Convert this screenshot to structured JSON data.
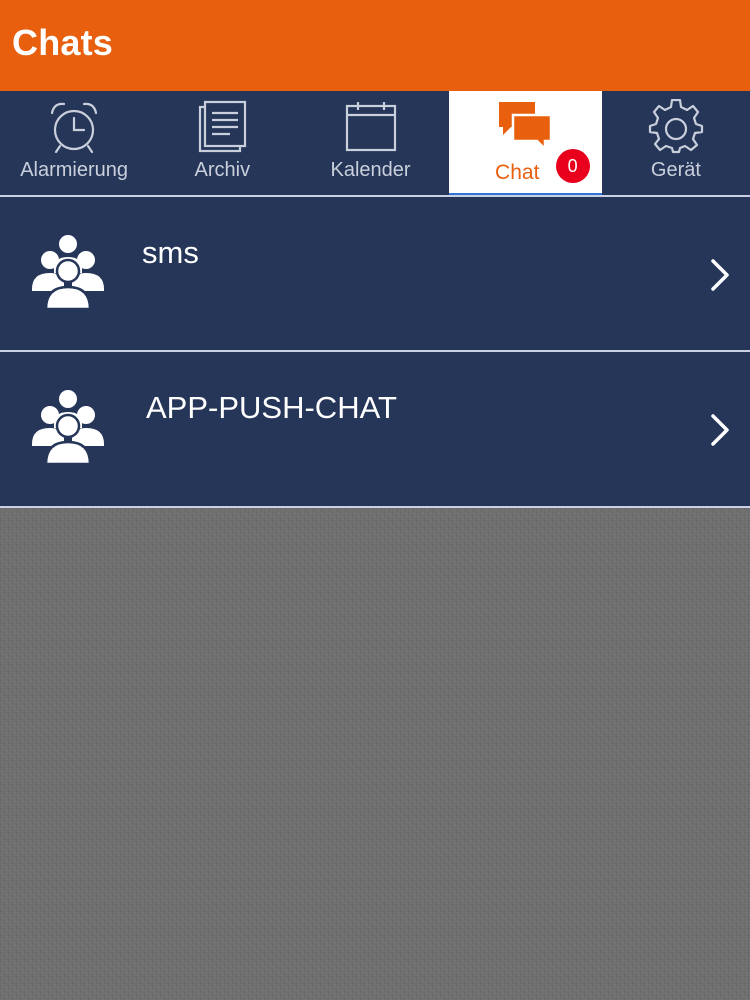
{
  "header": {
    "title": "Chats"
  },
  "tabs": [
    {
      "label": "Alarmierung",
      "icon": "alarm-clock-icon"
    },
    {
      "label": "Archiv",
      "icon": "document-icon"
    },
    {
      "label": "Kalender",
      "icon": "calendar-icon"
    },
    {
      "label": "Chat",
      "icon": "chat-bubbles-icon",
      "badge": "0",
      "active": true
    },
    {
      "label": "Gerät",
      "icon": "gear-icon"
    }
  ],
  "chats": [
    {
      "name": "sms",
      "icon": "group-icon"
    },
    {
      "name": "APP-PUSH-CHAT",
      "icon": "group-icon"
    }
  ],
  "colors": {
    "header_bg": "#e8600e",
    "nav_bg": "#263659",
    "accent": "#e8600e",
    "badge": "#e8001c",
    "active_indicator": "#2f74d6"
  }
}
